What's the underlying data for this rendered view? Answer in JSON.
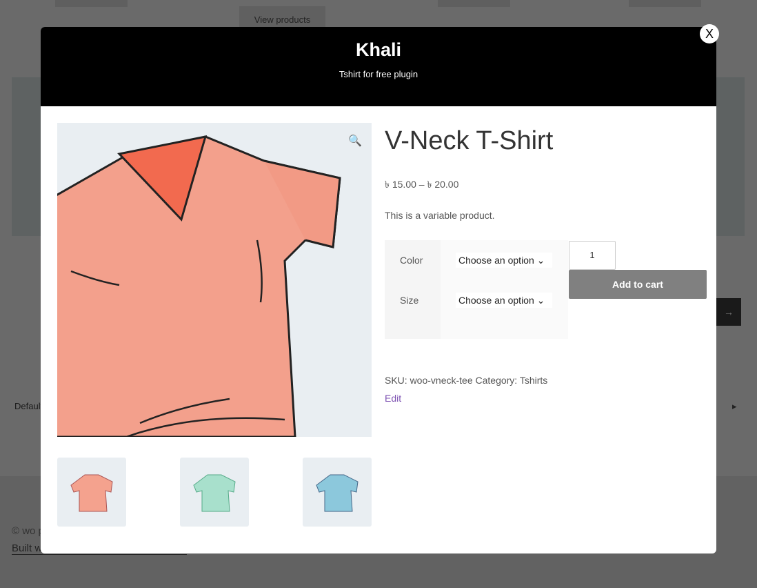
{
  "background": {
    "view_products": "View products",
    "sort_text": "Default",
    "copyright": "© wo p",
    "built_with": "Built w",
    "arrow": "→",
    "next": "▸"
  },
  "modal": {
    "title": "Khali",
    "subtitle": "Tshirt for free plugin",
    "close": "X",
    "product": {
      "name": "V-Neck T-Shirt",
      "price": "৳ 15.00 – ৳ 20.00",
      "description": "This is a variable product.",
      "variations": [
        {
          "label": "Color",
          "value": "Choose an option"
        },
        {
          "label": "Size",
          "value": "Choose an option"
        }
      ],
      "quantity": "1",
      "add_to_cart": "Add to cart",
      "meta": "SKU: woo-vneck-tee Category: Tshirts",
      "edit": "Edit",
      "thumbnails": [
        {
          "color": "#f4a28e"
        },
        {
          "color": "#a8e0cc"
        },
        {
          "color": "#8cc8dc"
        }
      ]
    }
  }
}
